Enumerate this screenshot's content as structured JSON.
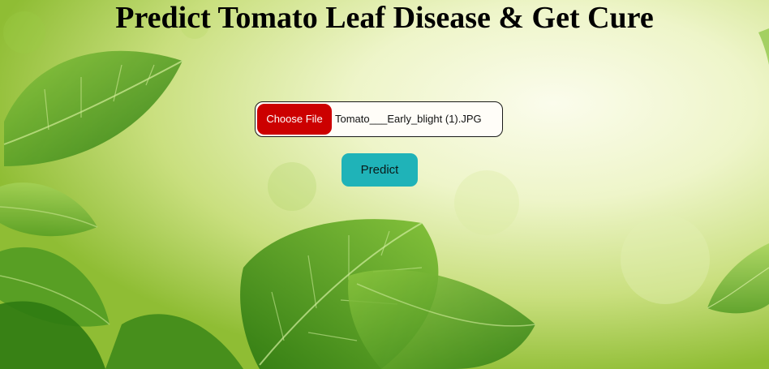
{
  "page": {
    "title": "Predict Tomato Leaf Disease & Get Cure"
  },
  "upload": {
    "choose_file_label": "Choose File",
    "selected_file_name": "Tomato___Early_blight (1).JPG"
  },
  "actions": {
    "predict_label": "Predict"
  },
  "colors": {
    "choose_button": "#cc0000",
    "predict_button": "#1fb3b8",
    "background_light": "#f4f8de",
    "background_green": "#9cc43a",
    "leaf_dark": "#3f8a1a"
  }
}
